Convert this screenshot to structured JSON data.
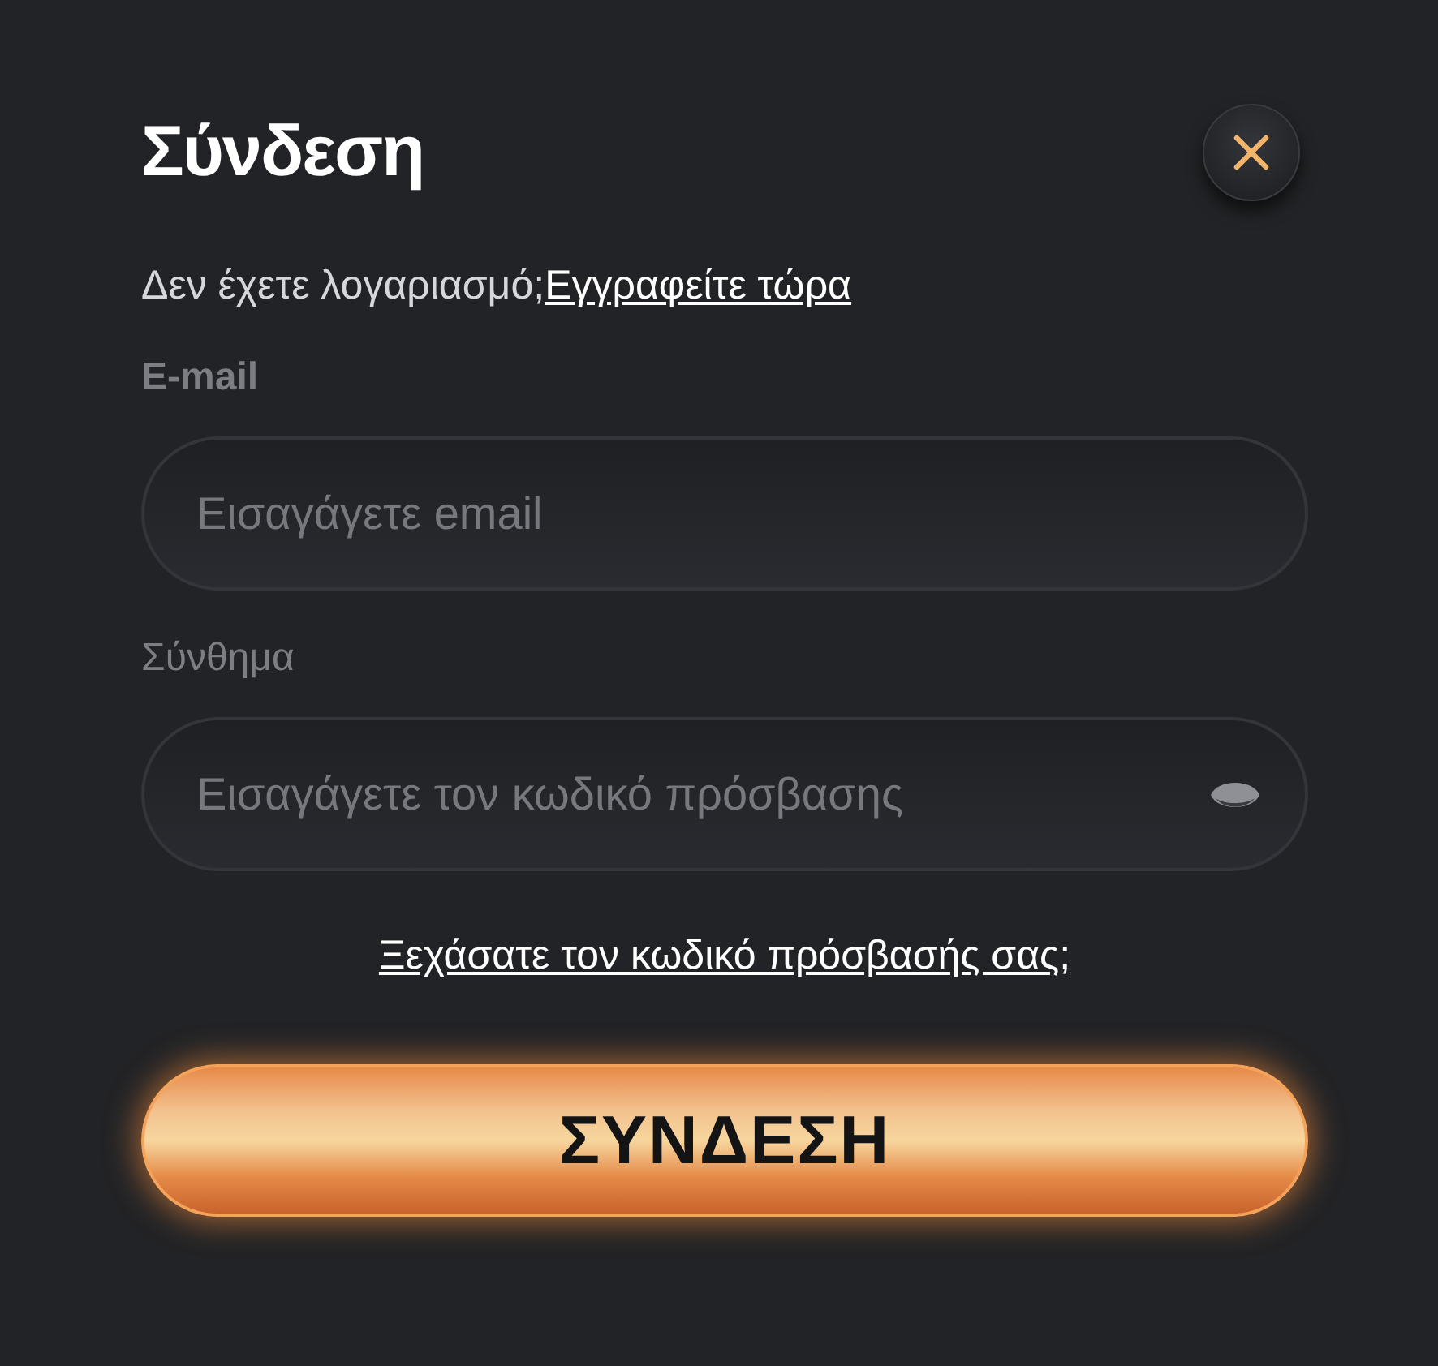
{
  "title": "Σύνδεση",
  "signup": {
    "text": "Δεν έχετε λογαριασμό;",
    "link": "Εγγραφείτε τώρα"
  },
  "fields": [
    {
      "kind": "email",
      "label": "E-mail",
      "placeholder": "Εισαγάγετε email"
    },
    {
      "kind": "password",
      "label": "Σύνθημα",
      "placeholder": "Εισαγάγετε τον κωδικό πρόσβασης"
    }
  ],
  "forgot_link": "Ξεχάσατε τον κωδικό πρόσβασής σας;",
  "submit_button": "ΣΥΝΔΕΣΗ"
}
